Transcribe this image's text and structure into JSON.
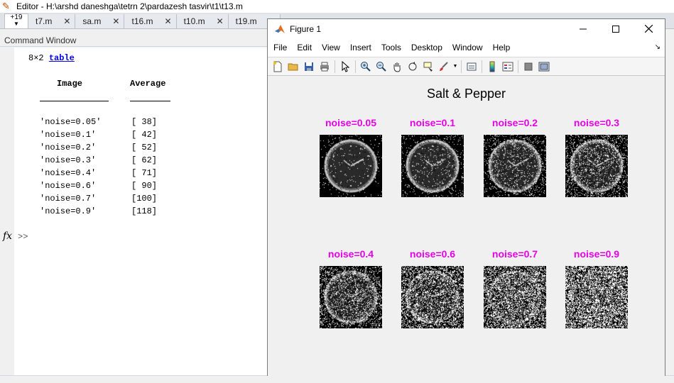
{
  "editor": {
    "title": "Editor - H:\\arshd daneshga\\tetrn 2\\pardazesh tasvir\\t1\\t13.m",
    "tab_overflow": "+19",
    "tabs": [
      "t7.m",
      "sa.m",
      "t16.m",
      "t10.m",
      "t19.m"
    ]
  },
  "command_window": {
    "header": "Command Window",
    "size_text": "8×2 ",
    "table_link": "table",
    "col_image": "Image",
    "col_average": "Average",
    "rows": [
      {
        "image": "'noise=0.05'",
        "average": "[ 38]"
      },
      {
        "image": "'noise=0.1'",
        "average": "[ 42]"
      },
      {
        "image": "'noise=0.2'",
        "average": "[ 52]"
      },
      {
        "image": "'noise=0.3'",
        "average": "[ 62]"
      },
      {
        "image": "'noise=0.4'",
        "average": "[ 71]"
      },
      {
        "image": "'noise=0.6'",
        "average": "[ 90]"
      },
      {
        "image": "'noise=0.7'",
        "average": "[100]"
      },
      {
        "image": "'noise=0.9'",
        "average": "[118]"
      }
    ],
    "fx": "fx",
    "prompt": ">>"
  },
  "figure": {
    "title": "Figure 1",
    "menu": [
      "File",
      "Edit",
      "View",
      "Insert",
      "Tools",
      "Desktop",
      "Window",
      "Help"
    ],
    "sup_title": "Salt & Pepper",
    "subplots": [
      {
        "title": "noise=0.05",
        "density": 0.05
      },
      {
        "title": "noise=0.1",
        "density": 0.1
      },
      {
        "title": "noise=0.2",
        "density": 0.2
      },
      {
        "title": "noise=0.3",
        "density": 0.3
      },
      {
        "title": "noise=0.4",
        "density": 0.4
      },
      {
        "title": "noise=0.6",
        "density": 0.6
      },
      {
        "title": "noise=0.7",
        "density": 0.7
      },
      {
        "title": "noise=0.9",
        "density": 0.9
      }
    ],
    "subtitle_color": "#e600e6"
  }
}
